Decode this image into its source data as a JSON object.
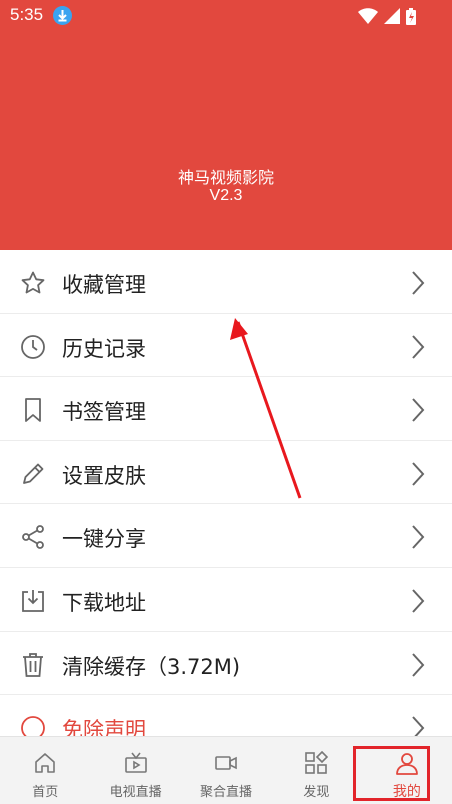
{
  "status_bar": {
    "time": "5:35"
  },
  "header": {
    "app_name": "神马视频影院",
    "version": "V2.3"
  },
  "menu": {
    "items": [
      {
        "label": "收藏管理",
        "icon": "star-icon"
      },
      {
        "label": "历史记录",
        "icon": "clock-icon"
      },
      {
        "label": "书签管理",
        "icon": "bookmark-icon"
      },
      {
        "label": "设置皮肤",
        "icon": "pencil-icon"
      },
      {
        "label": "一键分享",
        "icon": "share-icon"
      },
      {
        "label": "下载地址",
        "icon": "download-icon"
      },
      {
        "label": "清除缓存（3.72M)",
        "icon": "trash-icon"
      },
      {
        "label": "免除声明",
        "icon": "alert-icon"
      }
    ]
  },
  "bottom_nav": {
    "tabs": [
      {
        "label": "首页",
        "icon": "home-icon"
      },
      {
        "label": "电视直播",
        "icon": "tv-icon"
      },
      {
        "label": "聚合直播",
        "icon": "video-camera-icon"
      },
      {
        "label": "发现",
        "icon": "discover-icon"
      },
      {
        "label": "我的",
        "icon": "user-icon",
        "active": true
      }
    ]
  },
  "colors": {
    "brand_red": "#e2483e",
    "text_dark": "#222222",
    "nav_bg": "#f3f3f3",
    "badge_blue": "#3aa3f0"
  }
}
